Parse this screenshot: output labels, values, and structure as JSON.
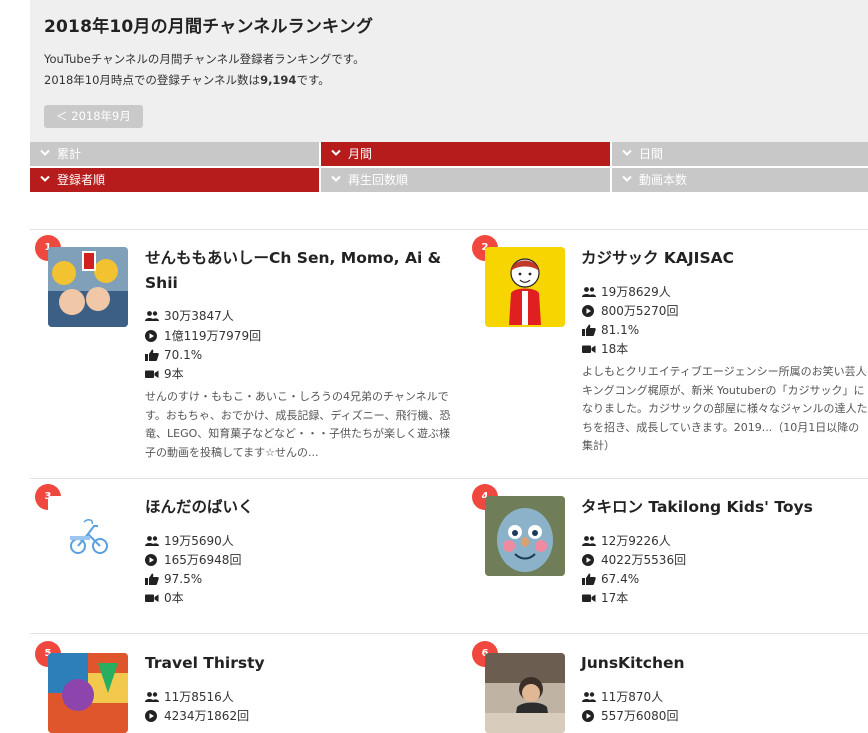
{
  "header": {
    "title": "2018年10月の月間チャンネルランキング",
    "desc_line1": "YouTubeチャンネルの月間チャンネル登録者ランキングです。",
    "desc_line2_prefix": "2018年10月時点での登録チャンネル数は",
    "desc_line2_count": "9,194",
    "desc_line2_suffix": "です。",
    "prev_button": "＜ 2018年9月"
  },
  "tabs": {
    "period": [
      {
        "label": "累計",
        "active": false
      },
      {
        "label": "月間",
        "active": true
      },
      {
        "label": "日間",
        "active": false
      }
    ],
    "sort": [
      {
        "label": "登録者順",
        "active": true
      },
      {
        "label": "再生回数順",
        "active": false
      },
      {
        "label": "動画本数",
        "active": false
      }
    ]
  },
  "colors": {
    "accent": "#b71c1c",
    "inactive_tab": "#c8c8c8",
    "rank_badge": "#f0483e",
    "header_bg": "#efefef"
  },
  "icons": {
    "subscribers": "people-icon",
    "views": "play-circle-icon",
    "likes": "thumbs-up-icon",
    "videos": "video-camera-icon",
    "tab": "chevron-down-icon"
  },
  "channels": [
    {
      "rank": "1",
      "name": "せんももあいしーCh Sen, Momo, Ai & Shii",
      "subscribers": "30万3847人",
      "views": "1億119万7979回",
      "like_rate": "70.1%",
      "videos": "9本",
      "description": "せんのすけ・ももこ・あいこ・しろうの4兄弟のチャンネルです。おもちゃ、おでかけ、成長記録、ディズニー、飛行機、恐竜、LEGO、知育菓子などなど・・・子供たちが楽しく遊ぶ様子の動画を投稿してます☆せんの..."
    },
    {
      "rank": "2",
      "name": "カジサック KAJISAC",
      "subscribers": "19万8629人",
      "views": "800万5270回",
      "like_rate": "81.1%",
      "videos": "18本",
      "description": "よしもとクリエイティブエージェンシー所属のお笑い芸人キングコング梶原が、新米 Youtuberの「カジサック」になりました。カジサックの部屋に様々なジャンルの達人たちを招き、成長していきます。2019...（10月1日以降の集計）"
    },
    {
      "rank": "3",
      "name": "ほんだのばいく",
      "subscribers": "19万5690人",
      "views": "165万6948回",
      "like_rate": "97.5%",
      "videos": "0本",
      "description": ""
    },
    {
      "rank": "4",
      "name": "タキロン Takilong Kids' Toys",
      "subscribers": "12万9226人",
      "views": "4022万5536回",
      "like_rate": "67.4%",
      "videos": "17本",
      "description": ""
    },
    {
      "rank": "5",
      "name": "Travel Thirsty",
      "subscribers": "11万8516人",
      "views": "4234万1862回",
      "like_rate": "",
      "videos": "",
      "description": ""
    },
    {
      "rank": "6",
      "name": "JunsKitchen",
      "subscribers": "11万870人",
      "views": "557万6080回",
      "like_rate": "",
      "videos": "",
      "description": ""
    }
  ]
}
